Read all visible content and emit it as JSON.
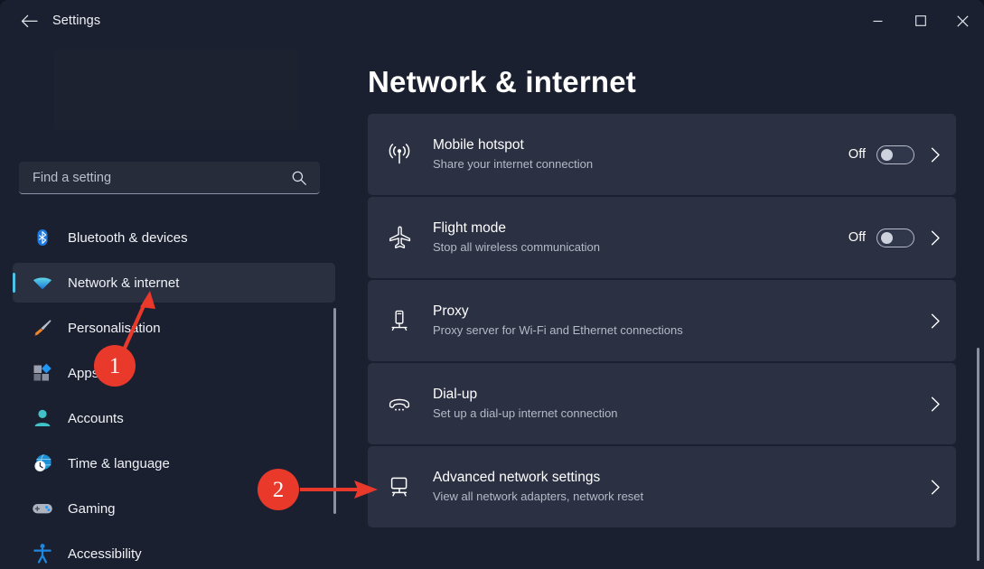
{
  "window": {
    "title": "Settings",
    "back_icon": "back-arrow-icon",
    "minimize_label": "─",
    "maximize_label": "□",
    "close_label": "✕"
  },
  "search": {
    "placeholder": "Find a setting",
    "value": "",
    "icon": "search-icon"
  },
  "sidebar": {
    "items": [
      {
        "label": "Bluetooth & devices",
        "icon": "bluetooth-icon",
        "selected": false
      },
      {
        "label": "Network & internet",
        "icon": "wifi-icon",
        "selected": true
      },
      {
        "label": "Personalisation",
        "icon": "paintbrush-icon",
        "selected": false
      },
      {
        "label": "Apps",
        "icon": "apps-icon",
        "selected": false
      },
      {
        "label": "Accounts",
        "icon": "account-icon",
        "selected": false
      },
      {
        "label": "Time & language",
        "icon": "clock-globe-icon",
        "selected": false
      },
      {
        "label": "Gaming",
        "icon": "gamepad-icon",
        "selected": false
      },
      {
        "label": "Accessibility",
        "icon": "accessibility-icon",
        "selected": false
      }
    ]
  },
  "main": {
    "title": "Network & internet",
    "cards": [
      {
        "title": "Mobile hotspot",
        "subtitle": "Share your internet connection",
        "icon": "hotspot-icon",
        "toggle": {
          "state_label": "Off",
          "on": false
        },
        "chevron": "chevron-right-icon"
      },
      {
        "title": "Flight mode",
        "subtitle": "Stop all wireless communication",
        "icon": "airplane-icon",
        "toggle": {
          "state_label": "Off",
          "on": false
        },
        "chevron": "chevron-right-icon"
      },
      {
        "title": "Proxy",
        "subtitle": "Proxy server for Wi-Fi and Ethernet connections",
        "icon": "proxy-server-icon",
        "toggle": null,
        "chevron": "chevron-right-icon"
      },
      {
        "title": "Dial-up",
        "subtitle": "Set up a dial-up internet connection",
        "icon": "dialup-phone-icon",
        "toggle": null,
        "chevron": "chevron-right-icon"
      },
      {
        "title": "Advanced network settings",
        "subtitle": "View all network adapters, network reset",
        "icon": "advanced-network-icon",
        "toggle": null,
        "chevron": "chevron-right-icon"
      }
    ]
  },
  "annotations": {
    "badges": [
      {
        "label": "1",
        "target": "Network & internet sidebar item"
      },
      {
        "label": "2",
        "target": "Advanced network settings card"
      }
    ],
    "color": "#e8392b"
  },
  "colors": {
    "window_background": "#1b2030",
    "card_background": "#2b3042",
    "accent": "#4cc2e6",
    "selected_nav_background": "#2a3040",
    "annotation_red": "#e8392b",
    "text_primary": "#ffffff",
    "text_secondary": "#b4bac7"
  }
}
